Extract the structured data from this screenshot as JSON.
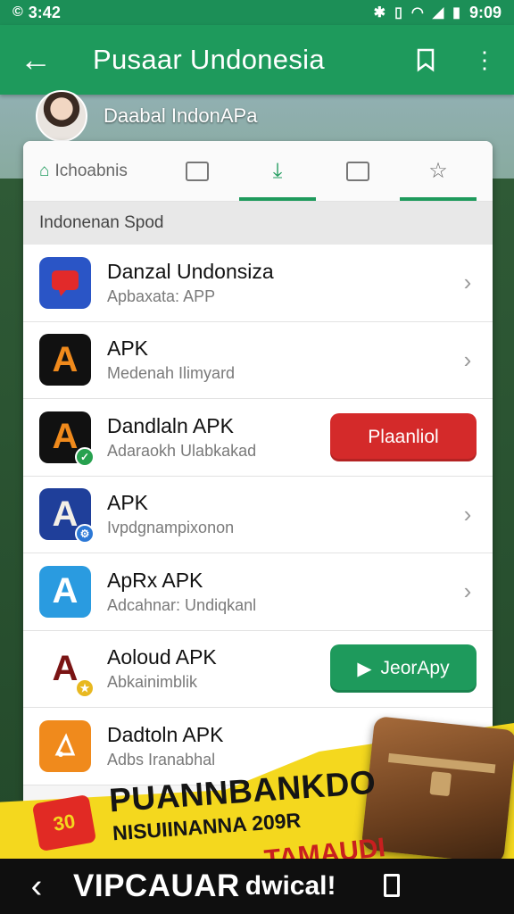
{
  "status_bar": {
    "left_text": "3:42",
    "time": "9:09"
  },
  "app_bar": {
    "title": "Pusaar Undonesia"
  },
  "profile": {
    "name": "Daabal IndonAPa"
  },
  "tabs": [
    {
      "label": "Ichoabnis"
    }
  ],
  "section": {
    "label": "Indonenan Spod"
  },
  "apps": [
    {
      "title": "Danzal Undonsiza",
      "subtitle": "Apbaxata: APP",
      "icon_letter": "",
      "icon_name": "chat-icon",
      "action": "chevron"
    },
    {
      "title": "APK",
      "subtitle": "Medenah Ilimyard",
      "icon_letter": "A",
      "icon_name": "apk-icon",
      "action": "chevron"
    },
    {
      "title": "Dandlaln APK",
      "subtitle": "Adaraokh Ulabkakad",
      "icon_letter": "A",
      "icon_name": "apk-icon",
      "action": "button",
      "button_label": "Plaanliol"
    },
    {
      "title": "APK",
      "subtitle": "Ivpdgnampixonon",
      "icon_letter": "A",
      "icon_name": "apk-icon",
      "action": "chevron"
    },
    {
      "title": "ApRx APK",
      "subtitle": "Adcahnar: Undiqkanl",
      "icon_letter": "A",
      "icon_name": "apk-icon",
      "action": "chevron"
    },
    {
      "title": "Aoloud APK",
      "subtitle": "Abkainimblik",
      "icon_letter": "A",
      "icon_name": "apk-icon",
      "action": "button",
      "button_label": "JeorApy"
    },
    {
      "title": "Dadtoln APK",
      "subtitle": "Adbs Iranabhal",
      "icon_letter": "",
      "icon_name": "play-icon",
      "action": "none"
    }
  ],
  "promo": {
    "logo_text": "30",
    "title": "PUANNBANKDO",
    "subtitle": "NISUIINANNA 209R",
    "red_text": "TAMAUDI"
  },
  "bottom_bar": {
    "text": "VIPCAUAR",
    "text2": "dwical!"
  },
  "colors": {
    "primary": "#1e9a5c",
    "danger": "#d42a2a",
    "promo": "#f4d81e"
  }
}
